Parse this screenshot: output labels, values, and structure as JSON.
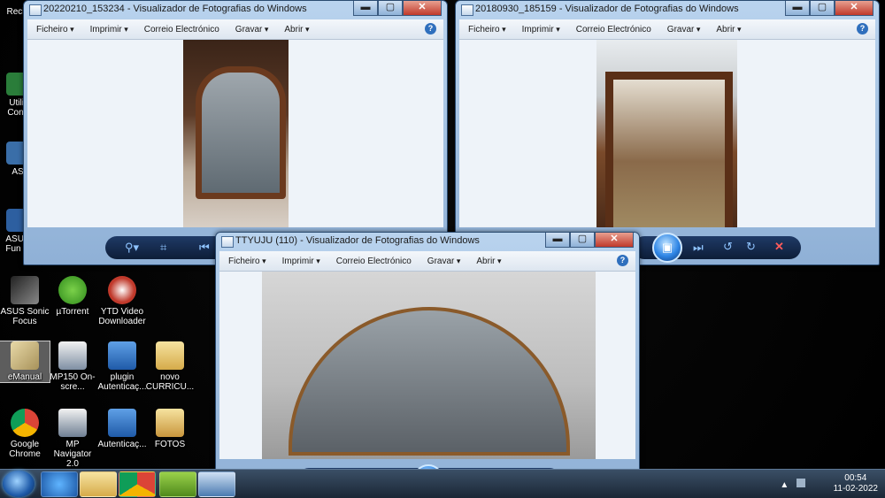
{
  "desktop": {
    "icons": [
      {
        "name": "recycle-bin",
        "label": "Recic"
      },
      {
        "name": "utility",
        "label": "Utilit Confi"
      },
      {
        "name": "asus",
        "label": "AS"
      },
      {
        "name": "asus-fun",
        "label": "ASUS Fun C"
      },
      {
        "name": "asus-sonic-focus",
        "label": "ASUS Sonic Focus"
      },
      {
        "name": "utorrent",
        "label": "µTorrent"
      },
      {
        "name": "ytd",
        "label": "YTD Video Downloader"
      },
      {
        "name": "emanual",
        "label": "eManual"
      },
      {
        "name": "mp150",
        "label": "MP150 On-scre..."
      },
      {
        "name": "plugin",
        "label": "plugin Autenticaç..."
      },
      {
        "name": "novo",
        "label": "novo CURRICU..."
      },
      {
        "name": "chrome",
        "label": "Google Chrome"
      },
      {
        "name": "mp-navigator",
        "label": "MP Navigator 2.0"
      },
      {
        "name": "autenticacao",
        "label": "Autenticaç..."
      },
      {
        "name": "fotos",
        "label": "FOTOS"
      }
    ]
  },
  "windows": [
    {
      "title": "20220210_153234 - Visualizador de Fotografias do Windows"
    },
    {
      "title": "20180930_185159 - Visualizador de Fotografias do Windows"
    },
    {
      "title": "TTYUJU (110) - Visualizador de Fotografias do Windows"
    }
  ],
  "menu": {
    "file": "Ficheiro",
    "print": "Imprimir",
    "email": "Correio Electrónico",
    "burn": "Gravar",
    "open": "Abrir",
    "help": "?"
  },
  "window_controls": {
    "minimize": "▬",
    "maximize": "▢",
    "close": "✕"
  },
  "viewer_controls": {
    "zoom": "⚲▾",
    "fit": "⌗",
    "prev": "⏮",
    "slideshow": "▣",
    "next": "⏭",
    "rotate_ccw": "↺",
    "rotate_cw": "↻",
    "delete": "✕"
  },
  "tray": {
    "time": "00:54",
    "date": "11-02-2022",
    "show_hidden": "▲"
  },
  "colors": {
    "taskbar": "#1b2736",
    "titlebar": "#b9d3ee",
    "close": "#c0392b",
    "viewer_bg": "#eef3f9"
  }
}
